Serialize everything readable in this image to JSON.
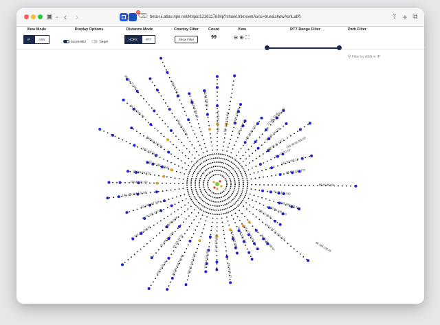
{
  "browser": {
    "url": "beta-ui.atlas.ripe.net/khipu/121611769/ip?showUnknownAsns=true&showAsnLab",
    "ext_badge": "99"
  },
  "toolbar": {
    "view_mode": {
      "title": "View Mode",
      "options": [
        "IP",
        "ASN"
      ],
      "selected": "IP"
    },
    "display_options": {
      "title": "Display Options",
      "successful_label": "Successful",
      "successful_on": true,
      "target_label": "Target",
      "target_on": false
    },
    "distance_mode": {
      "title": "Distance Mode",
      "options": [
        "HOPS",
        "RTT"
      ],
      "selected": "HOPS"
    },
    "country_filter": {
      "title": "Country Filter",
      "button_label": "Show Filter"
    },
    "count": {
      "title": "Count",
      "value": "99"
    },
    "view": {
      "title": "View"
    },
    "rtt_range": {
      "title": "RTT Range Filter",
      "low": 0.0,
      "high": 1.0
    },
    "path_filter": {
      "title": "Path Filter",
      "placeholder": "Filter by ASN or IP"
    }
  },
  "graph": {
    "center_color": "#7ac943",
    "node_colors": {
      "hop": "#111111",
      "probe": "#1f1fd6",
      "asn_hop": "#e0a020",
      "unknown": "#e23030"
    },
    "ring_count": 8,
    "spoke_count": 44,
    "labels": [
      "84.95.97.176.164",
      "181.113.103.160",
      "194.95.238.54",
      "193.134.7.2",
      "148.38.48.173",
      "149.96.236.170",
      "163.80.190.151",
      "193.90.27.130",
      "81.171.72.13",
      "194.55.155.13",
      "89.153.212.179",
      "88.46.98.92",
      "70.71.106.243",
      "195.185.151.248",
      "83.96.139.223",
      "165.12.45.63",
      "144.174.73.145.215",
      "86.80.26.148.92",
      "165.177.49.23",
      "87.96.150.221",
      "81.131.47.208",
      "52.56.66.12",
      "87.49.105.171",
      "179.64.228.200",
      "202.22.144.12.69",
      "101.99.254.104.49",
      "102.6.135.34",
      "62.199.182.199",
      "176.194.5.56",
      "77.243.106.200.61",
      "62.77.225.131.21",
      "63.143.167.109",
      "182.171.204.124.69",
      "216.98.58.182",
      "97.194.76.212",
      "62.59.136.200.61",
      "185.128.46.36",
      "184.114.216.16",
      "94.244.221.96",
      "85.134.77.200",
      "194.126.253.28",
      "84.111.141.42",
      "171.168.103.18",
      "84.109.120.55",
      "194.38.92.200.55",
      "71.195.73.45",
      "96.168.132.45",
      "83.115.20.23"
    ]
  }
}
